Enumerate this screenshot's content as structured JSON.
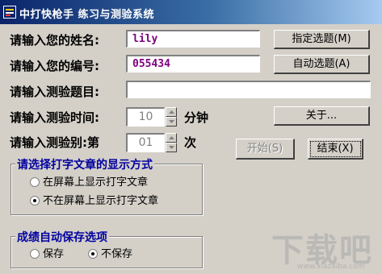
{
  "window": {
    "title": "中打快枪手  练习与测验系统"
  },
  "form": {
    "name_label": "请输入您的姓名:",
    "name_value": "lily",
    "id_label": "请输入您的编号:",
    "id_value": "055434",
    "topic_label": "请输入测验题目:",
    "topic_value": "",
    "time_label": "请输入测验时间:",
    "time_value": "10",
    "time_unit": "分钟",
    "level_label": "请输入测验别:第",
    "level_value": "01",
    "level_unit": "次"
  },
  "buttons": {
    "select_topic": "指定选题(M)",
    "auto_select": "自动选题(A)",
    "about": "关于...",
    "start": "开始(S)",
    "end": "结束(X)"
  },
  "display_group": {
    "title": "请选择打字文章的显示方式",
    "options": [
      "在屏幕上显示打字文章",
      "不在屏幕上显示打字文章"
    ],
    "selected_index": 1
  },
  "save_group": {
    "title": "成绩自动保存选项",
    "options": [
      "保存",
      "不保存"
    ],
    "selected_index": 1
  },
  "watermark": {
    "brand": "下载吧",
    "url": "www.xiazaiba.com"
  }
}
